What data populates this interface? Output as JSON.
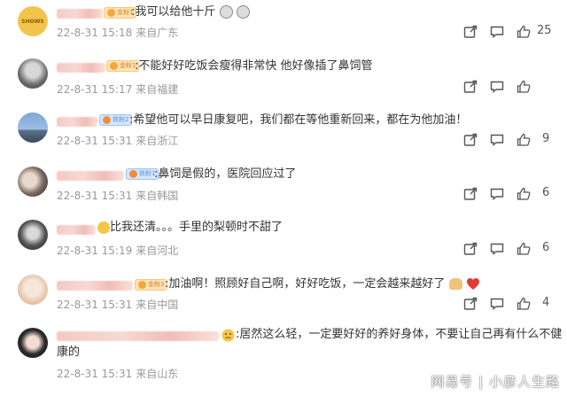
{
  "comments": [
    {
      "text": ":我可以给他十斤",
      "date": "22-8-31 15:18",
      "location": "来自广东",
      "likes": "25",
      "badge": "金粉1"
    },
    {
      "text": ":不能好好吃饭会瘦得非常快 他好像插了鼻饲管",
      "date": "22-8-31 15:17",
      "location": "来自福建",
      "likes": "",
      "badge": "金粉1"
    },
    {
      "text": ":希望他可以早日康复吧，我们都在等他重新回来，都在为他加油！",
      "date": "22-8-31 15:31",
      "location": "来自浙江",
      "likes": "9",
      "badge": "铁粉2"
    },
    {
      "text": ":鼻饲是假的，医院回应过了",
      "date": "22-8-31 15:31",
      "location": "来自韩国",
      "likes": "6",
      "badge": "铁粉1"
    },
    {
      "text": "比我还清。。。手里的梨顿时不甜了",
      "date": "22-8-31 15:19",
      "location": "来自河北",
      "likes": "6",
      "badge": ""
    },
    {
      "text": ":加油啊！照顾好自己啊，好好吃饭，一定会越来越好了",
      "date": "22-8-31 15:31",
      "location": "来自中国",
      "likes": "4",
      "badge": "金粉3"
    },
    {
      "text_line1": ":居然这么轻，一定要好好的养好身体，不要让自己再有什么不健",
      "text_line2": "康的",
      "date": "22-8-31 15:31",
      "location": "来自山东",
      "likes": "",
      "badge": ""
    }
  ],
  "watermark": "网易号 | 小彦人生路",
  "logo_text": "SHOWS",
  "colors": {
    "accent_fan": "#f7a63b",
    "meta": "#999999",
    "text": "#333333"
  },
  "icons": [
    "share-icon",
    "comment-icon",
    "like-icon"
  ]
}
